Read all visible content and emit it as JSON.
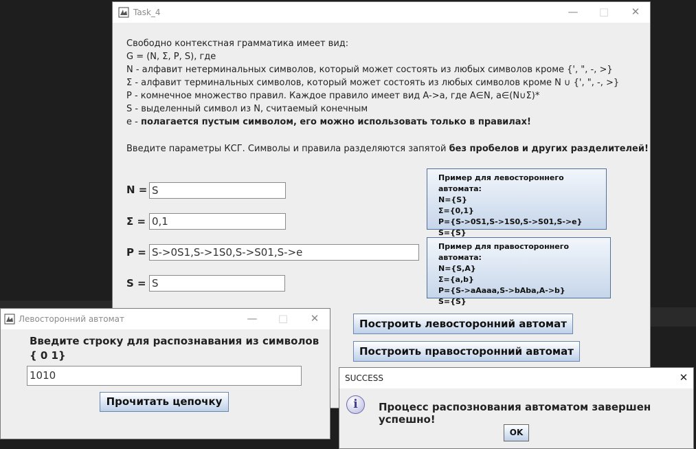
{
  "main_window": {
    "title": "Task_4",
    "description": [
      {
        "plain": "Свободно контекстная грамматика имеет вид:",
        "bold": ""
      },
      {
        "plain": "G = (N, Σ, P, S), где",
        "bold": ""
      },
      {
        "plain": "N - алфавит нетерминальных символов, который может состоять из любых символов кроме {', \", -, >}",
        "bold": ""
      },
      {
        "plain": "Σ - алфавит терминальных символов, который может состоять из любых символов кроме N ∪ {', \", -, >}",
        "bold": ""
      },
      {
        "plain": "P - комнечное множество правил. Каждое правило имеет вид A->a, где A∈N, a∈(N∪Σ)*",
        "bold": ""
      },
      {
        "plain": "S - выделенный символ из N, считаемый конечным",
        "bold": ""
      },
      {
        "plain": "e - ",
        "bold": "полагается пустым символом, его можно использовать только в правилах!"
      },
      {
        "plain": "Введите параметры КСГ. Символы и правила разделяются запятой ",
        "bold": "без пробелов и других разделителей!"
      }
    ],
    "fields": {
      "n_label": "N =",
      "n_value": "S",
      "sigma_label": "Σ =",
      "sigma_value": "0,1",
      "p_label": "P =",
      "p_value": "S->0S1,S->1S0,S->S01,S->e",
      "s_label": "S =",
      "s_value": "S"
    },
    "left_example": {
      "title": "Пример для левостороннего автомата:",
      "lines": [
        "N={S}",
        "Σ={0,1}",
        "P={S->0S1,S->1S0,S->S01,S->e}",
        "S={S}"
      ]
    },
    "right_example": {
      "title": "Пример для правостороннего автомата:",
      "lines": [
        "N={S,A}",
        "Σ={a,b}",
        "P={S->aAaaa,S->bAba,A->b}",
        "S={S}"
      ]
    },
    "build_left_button": "Построить левосторонний автомат",
    "build_right_button": "Построить правосторонний автомат"
  },
  "automaton_window": {
    "title": "Левосторонний автомат",
    "prompt_line1": "Введите строку для распознавания из символов",
    "prompt_line2": "{ 0 1}",
    "input_value": "1010",
    "read_button": "Прочитать цепочку"
  },
  "success_dialog": {
    "title": "SUCCESS",
    "info_icon_glyph": "i",
    "message": "Процесс распознования автоматом завершен успешно!",
    "ok_button": "OK"
  }
}
